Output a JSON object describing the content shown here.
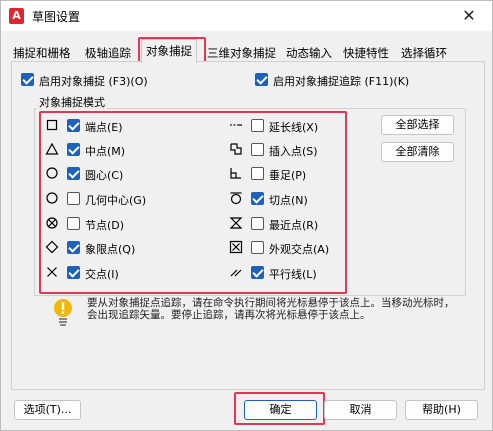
{
  "window": {
    "title": "草图设置",
    "app_icon_letter": "A",
    "close_glyph": "✕"
  },
  "tabs": [
    {
      "label": "捕捉和栅格"
    },
    {
      "label": "极轴追踪"
    },
    {
      "label": "对象捕捉"
    },
    {
      "label": "三维对象捕捉"
    },
    {
      "label": "动态输入"
    },
    {
      "label": "快捷特性"
    },
    {
      "label": "选择循环"
    }
  ],
  "top_options": {
    "snap_on": {
      "label": "启用对象捕捉 (F3)(O)",
      "checked": true
    },
    "tracking_on": {
      "label": "启用对象捕捉追踪 (F11)(K)",
      "checked": true
    }
  },
  "group": {
    "title": "对象捕捉模式"
  },
  "modes_left": [
    {
      "label": "端点(E)",
      "checked": true,
      "icon": "square-icon"
    },
    {
      "label": "中点(M)",
      "checked": true,
      "icon": "triangle-icon"
    },
    {
      "label": "圆心(C)",
      "checked": true,
      "icon": "circle-icon"
    },
    {
      "label": "几何中心(G)",
      "checked": false,
      "icon": "geometric-center-icon"
    },
    {
      "label": "节点(D)",
      "checked": false,
      "icon": "node-icon"
    },
    {
      "label": "象限点(Q)",
      "checked": true,
      "icon": "diamond-icon"
    },
    {
      "label": "交点(I)",
      "checked": true,
      "icon": "cross-icon"
    }
  ],
  "modes_right": [
    {
      "label": "延长线(X)",
      "checked": false,
      "icon": "extension-icon"
    },
    {
      "label": "插入点(S)",
      "checked": false,
      "icon": "insertion-icon"
    },
    {
      "label": "垂足(P)",
      "checked": false,
      "icon": "perpendicular-icon"
    },
    {
      "label": "切点(N)",
      "checked": true,
      "icon": "tangent-icon"
    },
    {
      "label": "最近点(R)",
      "checked": false,
      "icon": "nearest-icon"
    },
    {
      "label": "外观交点(A)",
      "checked": false,
      "icon": "apparent-intersection-icon"
    },
    {
      "label": "平行线(L)",
      "checked": true,
      "icon": "parallel-icon"
    }
  ],
  "side_buttons": {
    "select_all": "全部选择",
    "clear_all": "全部清除"
  },
  "info": {
    "text": "要从对象捕捉点追踪，请在命令执行期间将光标悬停于该点上。当移动光标时，会出现追踪矢量。要停止追踪，请再次将光标悬停于该点上。"
  },
  "footer": {
    "options": "选项(T)...",
    "ok": "确定",
    "cancel": "取消",
    "help": "帮助(H)"
  },
  "colors": {
    "accent": "#1c62b9",
    "highlight": "#e0384f"
  }
}
